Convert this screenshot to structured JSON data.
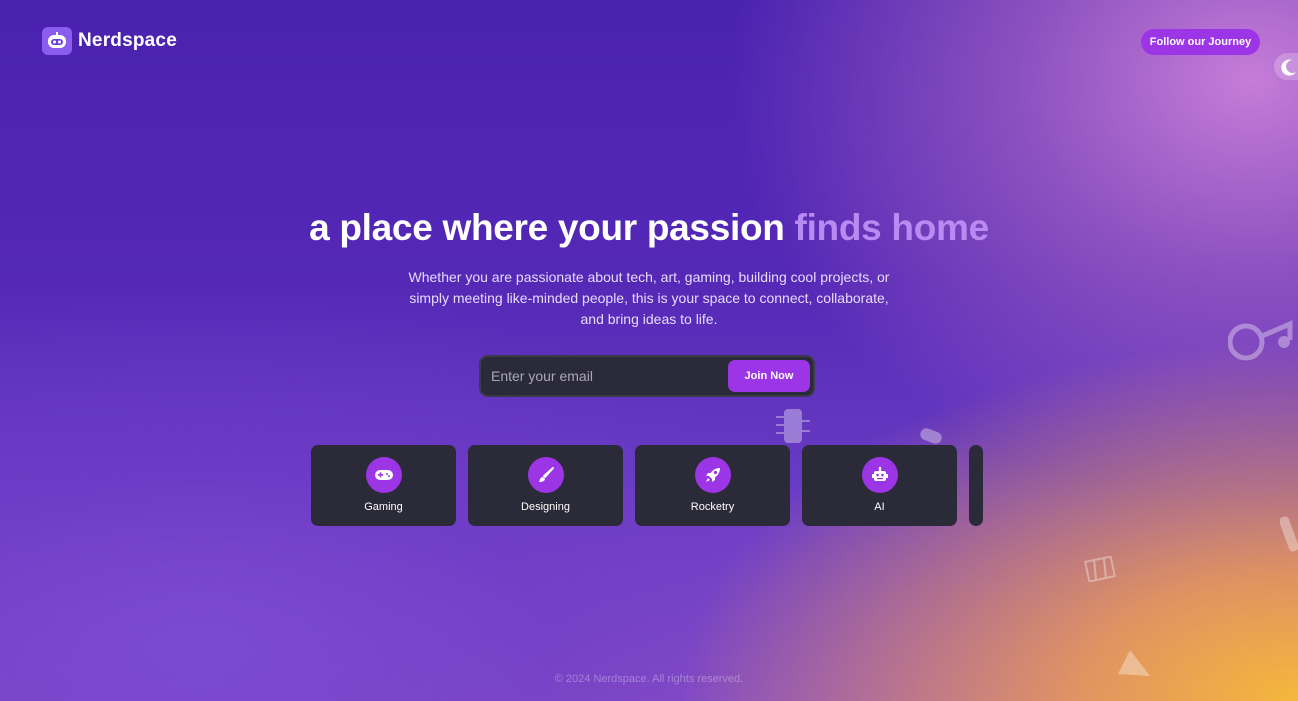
{
  "brand": {
    "name": "Nerdspace",
    "logo_icon": "robot-face-icon"
  },
  "header": {
    "follow_label": "Follow our Journey",
    "theme_icon": "moon-icon"
  },
  "hero": {
    "title_main": "a place where your passion",
    "title_accent": "finds home",
    "subtitle": "Whether you are passionate about tech, art, gaming, building cool projects, or simply meeting like-minded people, this is your space to connect, collaborate, and bring ideas to life."
  },
  "signup": {
    "placeholder": "Enter your email",
    "button_label": "Join Now"
  },
  "categories": [
    {
      "label": "Gaming",
      "icon": "gamepad-icon"
    },
    {
      "label": "Designing",
      "icon": "paintbrush-icon"
    },
    {
      "label": "Rocketry",
      "icon": "rocket-icon"
    },
    {
      "label": "AI",
      "icon": "robot-icon"
    }
  ],
  "footer": {
    "text": "© 2024 Nerdspace. All rights reserved."
  },
  "colors": {
    "accent": "#9b35e6",
    "title_accent": "#b98af2",
    "card_bg": "#2b2a38"
  }
}
